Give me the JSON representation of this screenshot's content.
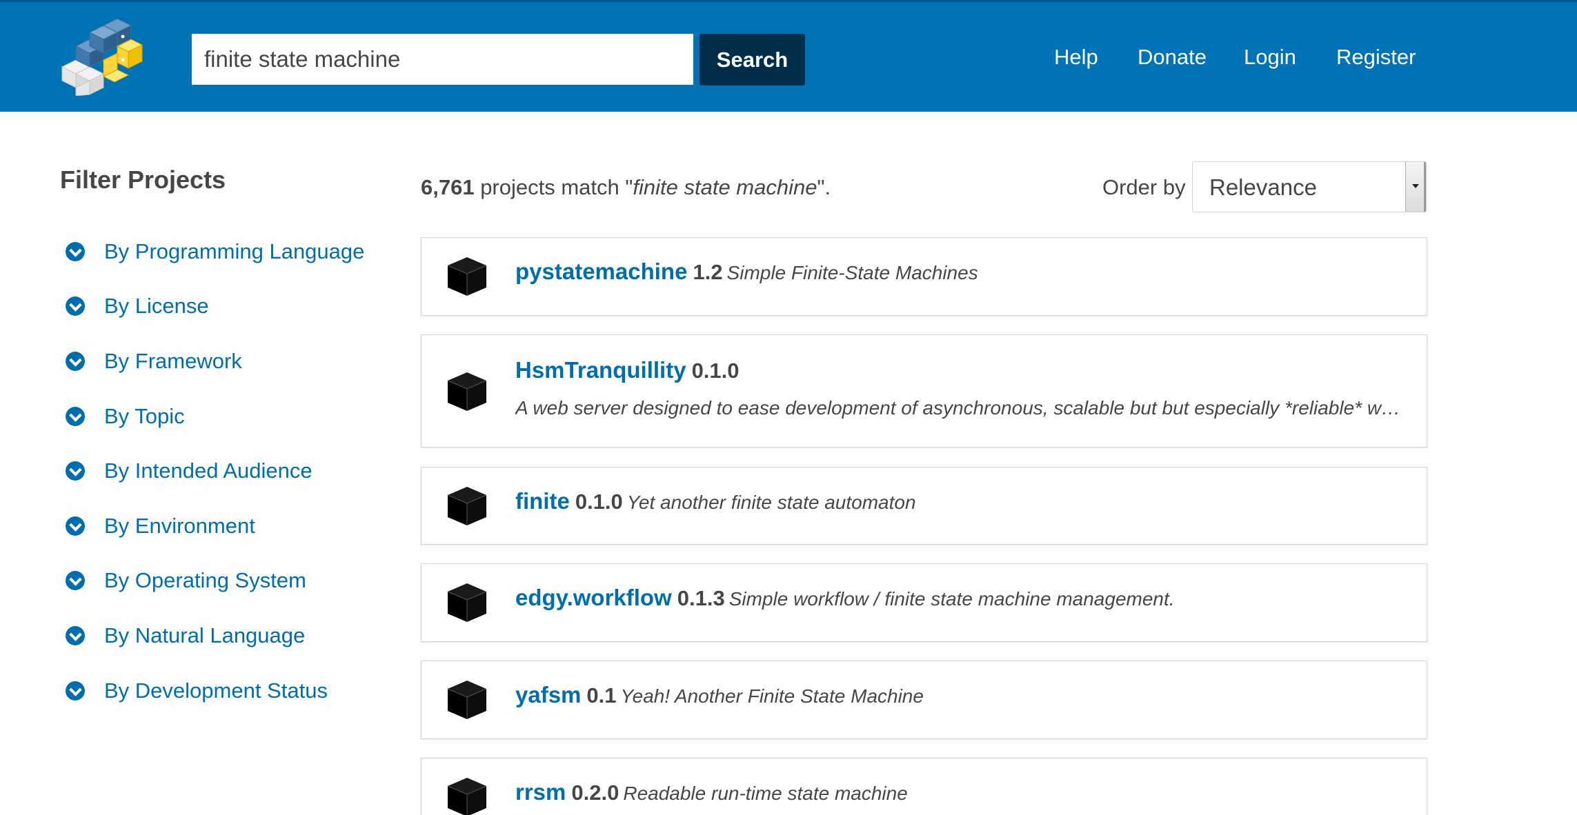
{
  "header": {
    "search_value": "finite state machine",
    "search_button": "Search",
    "nav": [
      "Help",
      "Donate",
      "Login",
      "Register"
    ]
  },
  "sidebar": {
    "title": "Filter Projects",
    "items": [
      {
        "label": "By Programming Language"
      },
      {
        "label": "By License"
      },
      {
        "label": "By Framework"
      },
      {
        "label": "By Topic"
      },
      {
        "label": "By Intended Audience"
      },
      {
        "label": "By Environment"
      },
      {
        "label": "By Operating System"
      },
      {
        "label": "By Natural Language"
      },
      {
        "label": "By Development Status"
      }
    ]
  },
  "results": {
    "count": "6,761",
    "match_prefix": " projects match \"",
    "query": "finite state machine",
    "match_suffix": "\".",
    "order_label": "Order by",
    "order_value": "Relevance",
    "items": [
      {
        "name": "pystatemachine",
        "version": "1.2",
        "description": "Simple Finite-State Machines"
      },
      {
        "name": "HsmTranquillity",
        "version": "0.1.0",
        "description": "A web server designed to ease development of asynchronous, scalable but but especially *reliable* web a…"
      },
      {
        "name": "finite",
        "version": "0.1.0",
        "description": "Yet another finite state automaton"
      },
      {
        "name": "edgy.workflow",
        "version": "0.1.3",
        "description": "Simple workflow / finite state machine management."
      },
      {
        "name": "yafsm",
        "version": "0.1",
        "description": "Yeah! Another Finite State Machine"
      },
      {
        "name": "rrsm",
        "version": "0.2.0",
        "description": "Readable run-time state machine"
      }
    ]
  },
  "colors": {
    "header_bg": "#0073b7",
    "search_button_bg": "#002d4a",
    "link": "#006dad"
  }
}
